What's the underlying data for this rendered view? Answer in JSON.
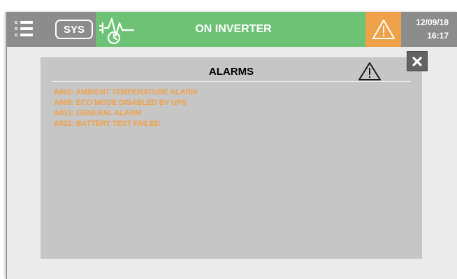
{
  "header": {
    "sys_label": "SYS",
    "status_text": "ON INVERTER",
    "date": "12/09/18",
    "time": "16:17",
    "menu_icon": "menu-list-icon",
    "status_icon": "inverter-waveform-clock-icon",
    "alarm_icon": "warning-triangle-icon"
  },
  "alarms_dialog": {
    "title": "ALARMS",
    "header_icon": "warning-triangle-icon",
    "close_icon": "close-x-icon",
    "items": [
      "A002: AMBIENT TEMPERATURE ALARM",
      "A008: ECO MODE DISABLED BY UPS",
      "A015: GENERAL ALARM",
      "A022: BATTERY TEST FAILED"
    ]
  },
  "colors": {
    "header_gray": "#8c8c8c",
    "status_green": "#6ec275",
    "alarm_orange": "#f0a24a",
    "panel_gray": "#c6c6c6",
    "background": "#ebebeb"
  }
}
